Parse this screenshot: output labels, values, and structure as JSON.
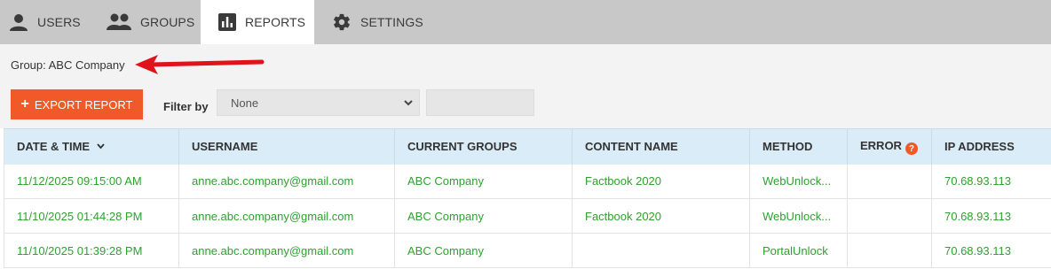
{
  "tabs": {
    "users": {
      "label": "USERS",
      "icon": "user-icon"
    },
    "groups": {
      "label": "GROUPS",
      "icon": "groups-icon"
    },
    "reports": {
      "label": "REPORTS",
      "icon": "bar-chart-icon",
      "active": true
    },
    "settings": {
      "label": "SETTINGS",
      "icon": "gear-icon"
    }
  },
  "toolbar": {
    "group_label": "Group: ABC Company",
    "export_label": "EXPORT REPORT",
    "filter_label": "Filter by",
    "filter_value": "None",
    "filter_text": ""
  },
  "colors": {
    "accent": "#f05a28",
    "link_green": "#2ea12e",
    "header_blue": "#d9ecf8",
    "annotation_arrow": "#e0121a"
  },
  "table": {
    "headers": {
      "datetime": "DATE & TIME",
      "username": "USERNAME",
      "groups": "CURRENT GROUPS",
      "content": "CONTENT NAME",
      "method": "METHOD",
      "error": "ERROR",
      "ip": "IP ADDRESS"
    },
    "rows": [
      {
        "datetime": "11/12/2025 09:15:00 AM",
        "username": "anne.abc.company@gmail.com",
        "groups": "ABC Company",
        "content": "Factbook 2020",
        "method": "WebUnlock...",
        "error": "",
        "ip": "70.68.93.113"
      },
      {
        "datetime": "11/10/2025 01:44:28 PM",
        "username": "anne.abc.company@gmail.com",
        "groups": "ABC Company",
        "content": "Factbook 2020",
        "method": "WebUnlock...",
        "error": "",
        "ip": "70.68.93.113"
      },
      {
        "datetime": "11/10/2025 01:39:28 PM",
        "username": "anne.abc.company@gmail.com",
        "groups": "ABC Company",
        "content": "",
        "method": "PortalUnlock",
        "error": "",
        "ip": "70.68.93.113"
      }
    ]
  }
}
